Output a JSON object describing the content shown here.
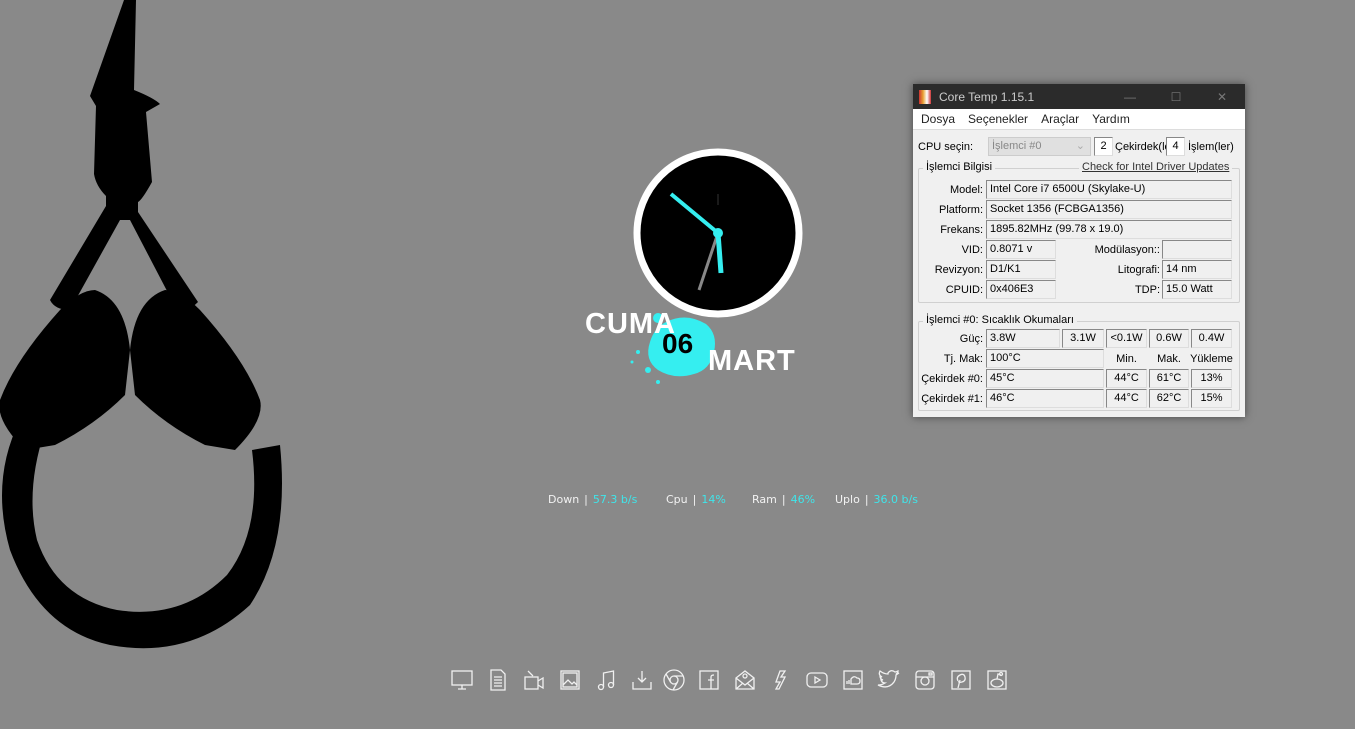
{
  "widget": {
    "day": "CUMA",
    "date": "06",
    "month": "MART"
  },
  "stats": [
    {
      "label": "Down",
      "value": "57.3 b/s"
    },
    {
      "label": "Cpu",
      "value": "14%"
    },
    {
      "label": "Ram",
      "value": "46%"
    },
    {
      "label": "Uplo",
      "value": "36.0 b/s"
    }
  ],
  "stats_sep": "|",
  "coretemp": {
    "title": "Core Temp 1.15.1",
    "controls": {
      "minimize": "—",
      "maximize": "☐",
      "close": "✕"
    },
    "menu": [
      "Dosya",
      "Seçenekler",
      "Araçlar",
      "Yardım"
    ],
    "cpu_select_label": "CPU seçin:",
    "cpu_select_value": "İşlemci #0",
    "cores": "2",
    "cores_label": "Çekirdek(le",
    "threads": "4",
    "threads_label": "İşlem(ler)",
    "info_title": "İşlemci Bilgisi",
    "driver_link": "Check for Intel Driver Updates",
    "model_label": "Model:",
    "model": "Intel Core i7 6500U (Skylake-U)",
    "platform_label": "Platform:",
    "platform": "Socket 1356 (FCBGA1356)",
    "freq_label": "Frekans:",
    "freq": "1895.82MHz (99.78 x 19.0)",
    "vid_label": "VID:",
    "vid": "0.8071 v",
    "mod_label": "Modülasyon::",
    "mod": "",
    "rev_label": "Revizyon:",
    "rev": "D1/K1",
    "lito_label": "Litografi:",
    "lito": "14 nm",
    "cpuid_label": "CPUID:",
    "cpuid": "0x406E3",
    "tdp_label": "TDP:",
    "tdp": "15.0 Watt",
    "temp_title": "İşlemci #0: Sıcaklık Okumaları",
    "power_label": "Güç:",
    "power": [
      "3.8W",
      "3.1W",
      "<0.1W",
      "0.6W",
      "0.4W"
    ],
    "tj_label": "Tj. Mak:",
    "tj": "100°C",
    "min_h": "Min.",
    "max_h": "Mak.",
    "load_h": "Yükleme",
    "cores_rows": [
      {
        "label": "Çekirdek #0:",
        "temp": "45°C",
        "min": "44°C",
        "max": "61°C",
        "load": "13%"
      },
      {
        "label": "Çekirdek #1:",
        "temp": "46°C",
        "min": "44°C",
        "max": "62°C",
        "load": "15%"
      }
    ]
  },
  "dock": [
    "monitor-icon",
    "document-icon",
    "video-icon",
    "image-icon",
    "music-icon",
    "download-icon",
    "chrome-icon",
    "facebook-icon",
    "mail-icon",
    "deviantart-icon",
    "youtube-icon",
    "soundcloud-icon",
    "twitter-icon",
    "instagram-icon",
    "pinterest-icon",
    "reddit-icon"
  ],
  "colors": {
    "accent": "#35eef0",
    "background": "#898989"
  }
}
